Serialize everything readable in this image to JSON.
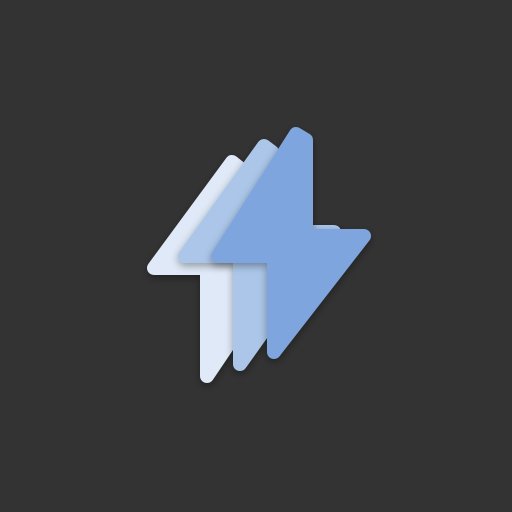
{
  "icon": {
    "name": "lightning-bolt-stack-icon",
    "background_color": "#333333",
    "layers": [
      {
        "name": "bolt-back",
        "color": "#dfe9f7"
      },
      {
        "name": "bolt-middle",
        "color": "#abc6e8"
      },
      {
        "name": "bolt-front",
        "color": "#7ea5dd"
      }
    ]
  }
}
